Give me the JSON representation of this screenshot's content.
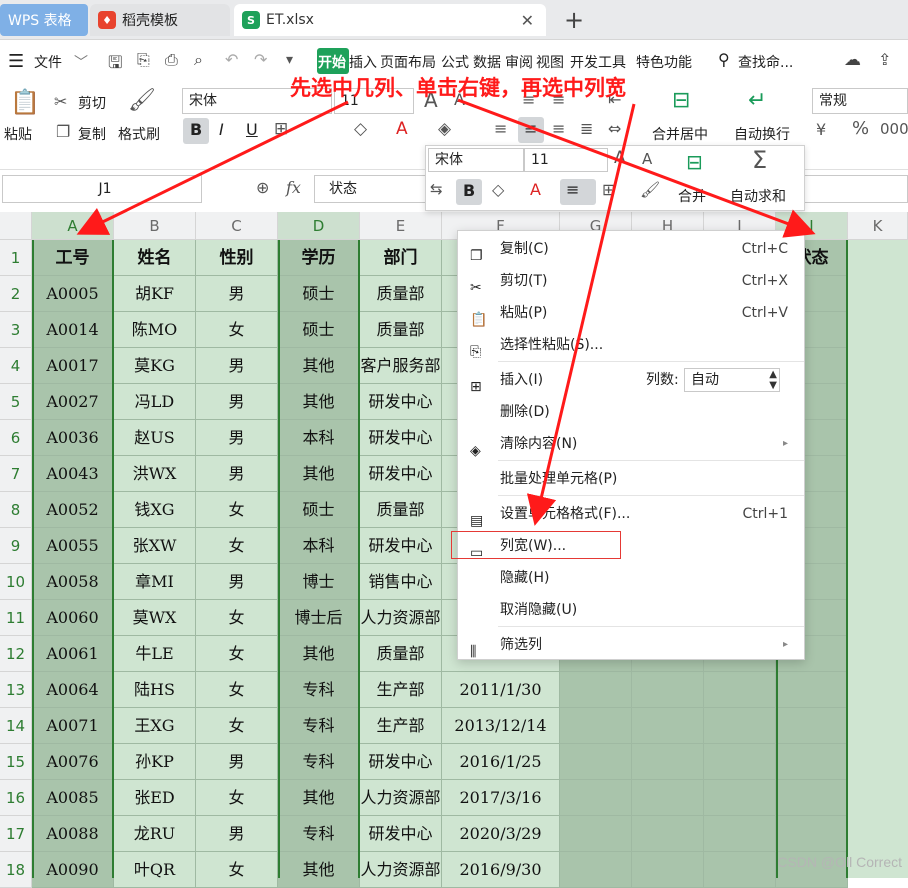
{
  "tabs": {
    "wps": "WPS 表格",
    "template": "稻壳模板",
    "file": "ET.xlsx",
    "close": "✕",
    "new": "+"
  },
  "menubar": {
    "file": "文件",
    "items": [
      "开始",
      "插入",
      "页面布局",
      "公式",
      "数据",
      "审阅",
      "视图",
      "开发工具",
      "特色功能"
    ],
    "search": "查找命..."
  },
  "ribbon": {
    "paste": "粘贴",
    "cut": "剪切",
    "copy": "复制",
    "format_painter": "格式刷",
    "font_name": "宋体",
    "font_size": "11",
    "bold": "B",
    "italic": "I",
    "underline": "U",
    "merge": "合并居中",
    "wrap": "自动换行",
    "number_format": "常规"
  },
  "annotation": "先选中几列、单击右键，再选中列宽",
  "formula_bar": {
    "name_box": "J1",
    "fx": "fx",
    "content": "状态"
  },
  "columns": [
    "A",
    "B",
    "C",
    "D",
    "E",
    "F",
    "G",
    "H",
    "I",
    "J",
    "K"
  ],
  "rows": [
    "1",
    "2",
    "3",
    "4",
    "5",
    "6",
    "7",
    "8",
    "9",
    "10",
    "11",
    "12",
    "13",
    "14",
    "15",
    "16",
    "17",
    "18"
  ],
  "headers": [
    "工号",
    "姓名",
    "性别",
    "学历",
    "部门",
    "",
    "",
    "",
    "",
    "状态"
  ],
  "data": [
    [
      "A0005",
      "胡KF",
      "男",
      "硕士",
      "质量部",
      ""
    ],
    [
      "A0014",
      "陈MO",
      "女",
      "硕士",
      "质量部",
      ""
    ],
    [
      "A0017",
      "莫KG",
      "男",
      "其他",
      "客户服务部",
      ""
    ],
    [
      "A0027",
      "冯LD",
      "男",
      "其他",
      "研发中心",
      ""
    ],
    [
      "A0036",
      "赵US",
      "男",
      "本科",
      "研发中心",
      ""
    ],
    [
      "A0043",
      "洪WX",
      "男",
      "其他",
      "研发中心",
      ""
    ],
    [
      "A0052",
      "钱XG",
      "女",
      "硕士",
      "质量部",
      ""
    ],
    [
      "A0055",
      "张XW",
      "女",
      "本科",
      "研发中心",
      ""
    ],
    [
      "A0058",
      "章MI",
      "男",
      "博士",
      "销售中心",
      ""
    ],
    [
      "A0060",
      "莫WX",
      "女",
      "博士后",
      "人力资源部",
      ""
    ],
    [
      "A0061",
      "牛LE",
      "女",
      "其他",
      "质量部",
      ""
    ],
    [
      "A0064",
      "陆HS",
      "女",
      "专科",
      "生产部",
      "2011/1/30"
    ],
    [
      "A0071",
      "王XG",
      "女",
      "专科",
      "生产部",
      "2013/12/14"
    ],
    [
      "A0076",
      "孙KP",
      "男",
      "专科",
      "研发中心",
      "2016/1/25"
    ],
    [
      "A0085",
      "张ED",
      "女",
      "其他",
      "人力资源部",
      "2017/3/16"
    ],
    [
      "A0088",
      "龙RU",
      "男",
      "专科",
      "研发中心",
      "2020/3/29"
    ],
    [
      "A0090",
      "叶QR",
      "女",
      "其他",
      "人力资源部",
      "2016/9/30"
    ]
  ],
  "mini_toolbar": {
    "font_name": "宋体",
    "font_size": "11",
    "merge": "合并",
    "autosum": "自动求和"
  },
  "context_menu": {
    "copy": "复制(C)",
    "copy_sc": "Ctrl+C",
    "cut": "剪切(T)",
    "cut_sc": "Ctrl+X",
    "paste": "粘贴(P)",
    "paste_sc": "Ctrl+V",
    "paste_special": "选择性粘贴(S)...",
    "insert": "插入(I)",
    "col_count_label": "列数:",
    "col_count_value": "自动",
    "delete": "删除(D)",
    "clear": "清除内容(N)",
    "batch": "批量处理单元格(P)",
    "format_cells": "设置单元格格式(F)...",
    "format_cells_sc": "Ctrl+1",
    "col_width": "列宽(W)...",
    "hide": "隐藏(H)",
    "unhide": "取消隐藏(U)",
    "filter": "筛选列"
  },
  "watermark": "CSDN @Oll Correct",
  "colors": {
    "accent_green": "#2e7d32",
    "annotation_red": "#ff1a1a",
    "cell_green": "#cfe5d1",
    "cell_selected": "#a9c4ab"
  }
}
